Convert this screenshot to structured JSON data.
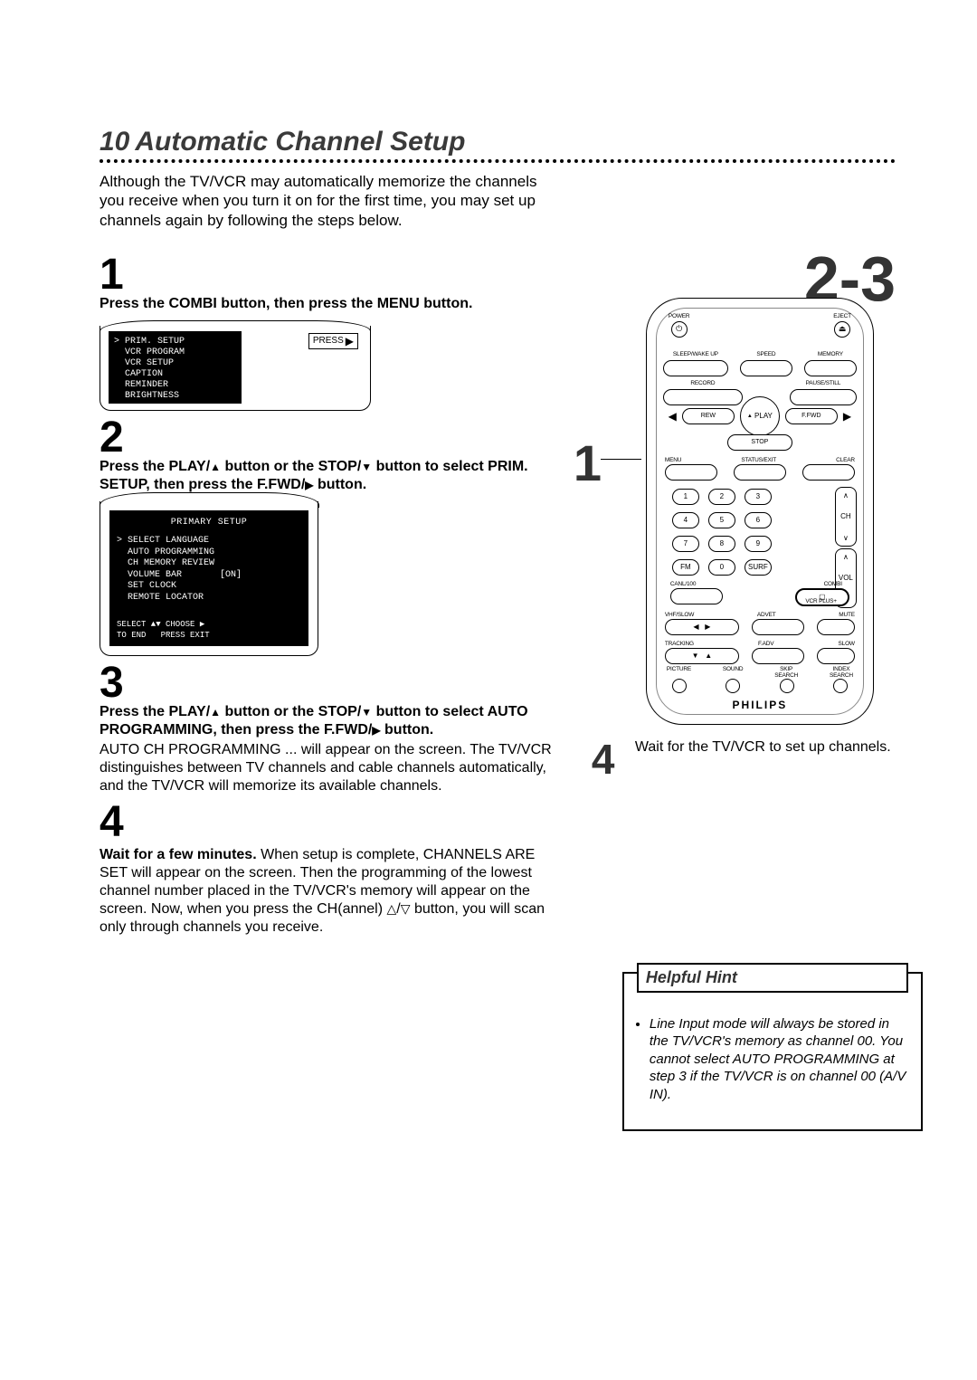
{
  "page_number": "10",
  "title": "Automatic Channel Setup",
  "intro": "Although the TV/VCR may automatically memorize the channels you receive when you turn it on for the first time, you may set up channels again by following the steps below.",
  "steps": {
    "s1": {
      "num": "1",
      "head": "Press the COMBI button, then press the MENU button."
    },
    "s2": {
      "num": "2",
      "head_a": "Press the PLAY/",
      "head_b": " button or the STOP/",
      "head_c": " button to select PRIM. SETUP, then press the F.FWD/",
      "head_d": " button."
    },
    "s3": {
      "num": "3",
      "head_a": "Press the PLAY/",
      "head_b": " button or the STOP/",
      "head_c": " button to select AUTO PROGRAMMING, then press the F.FWD/",
      "head_d": " button.",
      "body": "AUTO CH PROGRAMMING ... will appear on the screen. The TV/VCR distinguishes between TV channels and cable channels automatically, and the TV/VCR will memorize its available channels."
    },
    "s4": {
      "num": "4",
      "head": "Wait for a few minutes.",
      "body_a": " When setup is complete, CHANNELS ARE SET will appear on the screen. Then the programming of the lowest channel number placed in the TV/VCR's memory will appear on the screen. Now, when you press the CH(annel) ",
      "body_b": "/",
      "body_c": " button, you will scan only through channels you receive."
    }
  },
  "osd1": {
    "items": [
      "> PRIM. SETUP",
      "  VCR PROGRAM",
      "  VCR SETUP",
      "  CAPTION",
      "  REMINDER",
      "  BRIGHTNESS"
    ],
    "press": "PRESS"
  },
  "osd2": {
    "title": "PRIMARY SETUP",
    "items": [
      "> SELECT LANGUAGE",
      "  AUTO PROGRAMMING",
      "  CH MEMORY REVIEW",
      "  VOLUME BAR       [ON]",
      "  SET CLOCK",
      "  REMOTE LOCATOR"
    ],
    "footer": "SELECT ▲▼ CHOOSE ▶\nTO END   PRESS EXIT"
  },
  "right_callouts": {
    "one": "1",
    "two_three": "2-3",
    "four": "4",
    "four_text": "Wait for the TV/VCR to set up channels."
  },
  "remote": {
    "power": "POWER",
    "eject": "EJECT",
    "sleep": "SLEEP/WAKE UP",
    "speed": "SPEED",
    "memory": "MEMORY",
    "record": "RECORD",
    "pause": "PAUSE/STILL",
    "play": "PLAY",
    "rew": "REW",
    "ffwd": "F.FWD",
    "stop": "STOP",
    "menu": "MENU",
    "status": "STATUS/EXIT",
    "clear": "CLEAR",
    "keys": [
      "1",
      "2",
      "3",
      "4",
      "5",
      "6",
      "7",
      "8",
      "9",
      "FM",
      "0",
      "SURF"
    ],
    "ch": "CH",
    "vol": "VOL",
    "canl100": "CANL/100",
    "combi": "COMBI",
    "vhf": "VHF/SLOW",
    "advet": "ADVET",
    "mute": "MUTE",
    "tracking": "TRACKING",
    "fadv": "F.ADV",
    "slow": "SLOW",
    "vcrplus": "VCR PLUS+",
    "picture": "PICTURE",
    "sound": "SOUND",
    "skip": "SKIP\nSEARCH",
    "index": "INDEX\nSEARCH",
    "brand": "PHILIPS"
  },
  "hint": {
    "title": "Helpful Hint",
    "body": "Line Input mode will always be stored in the TV/VCR's memory as channel 00. You cannot select AUTO PROGRAMMING at step 3 if the TV/VCR is on channel 00 (A/V IN)."
  }
}
